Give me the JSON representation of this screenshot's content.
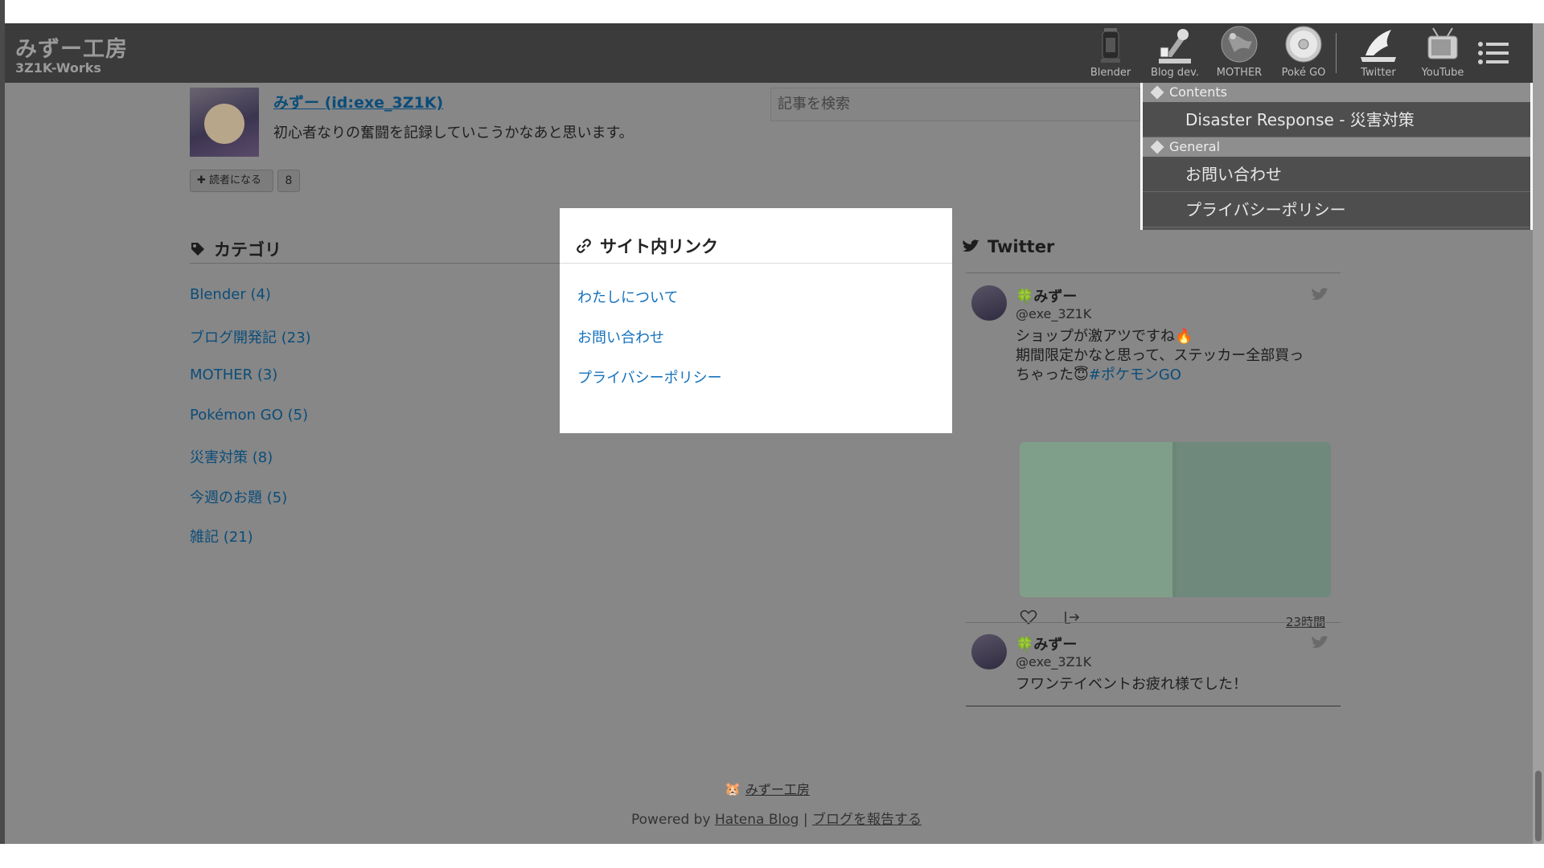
{
  "header": {
    "title": "みずー工房",
    "subtitle": "3Z1K-Works",
    "nav": [
      {
        "label": "Blender",
        "icon": "lantern-icon"
      },
      {
        "label": "Blog dev.",
        "icon": "microscope-icon"
      },
      {
        "label": "MOTHER",
        "icon": "earth-icon"
      },
      {
        "label": "Poké GO",
        "icon": "pokeball-icon"
      },
      {
        "label": "Twitter",
        "icon": "bird-icon"
      },
      {
        "label": "YouTube",
        "icon": "tv-icon"
      }
    ]
  },
  "dropdown": {
    "sections": [
      {
        "title": "Contents",
        "items": [
          "Disaster Response - 災害対策"
        ]
      },
      {
        "title": "General",
        "items": [
          "お問い合わせ",
          "プライバシーポリシー"
        ]
      }
    ]
  },
  "profile": {
    "name": "みずー (id:exe_3Z1K)",
    "description": "初心者なりの奮闘を記録していこうかなあと思います。",
    "reader_button": "読者になる",
    "reader_count": "8"
  },
  "search": {
    "placeholder": "記事を検索"
  },
  "categories": {
    "title": "カテゴリ",
    "items": [
      "Blender (4)",
      "ブログ開発記 (23)",
      "MOTHER (3)",
      "Pokémon GO (5)",
      "災害対策 (8)",
      "今週のお題 (5)",
      "雑記 (21)"
    ]
  },
  "modal": {
    "title": "サイト内リンク",
    "links": [
      "わたしについて",
      "お問い合わせ",
      "プライバシーポリシー"
    ]
  },
  "twitter": {
    "title": "Twitter",
    "tweets": [
      {
        "name": "みずー",
        "handle": "@exe_3Z1K",
        "text_line1": "ショップが激アツですね",
        "text_line2": "期間限定かなと思って、ステッカー全部買っ",
        "text_line3": "ちゃった",
        "hashtag": "#ポケモンGO",
        "time": "23時間"
      },
      {
        "name": "みずー",
        "handle": "@exe_3Z1K",
        "text_line1": "フワンテイベントお疲れ様でした！"
      }
    ]
  },
  "footer": {
    "site": "みずー工房",
    "powered_prefix": "Powered by",
    "powered_link": "Hatena Blog",
    "separator": "|",
    "report_link": "ブログを報告する"
  }
}
